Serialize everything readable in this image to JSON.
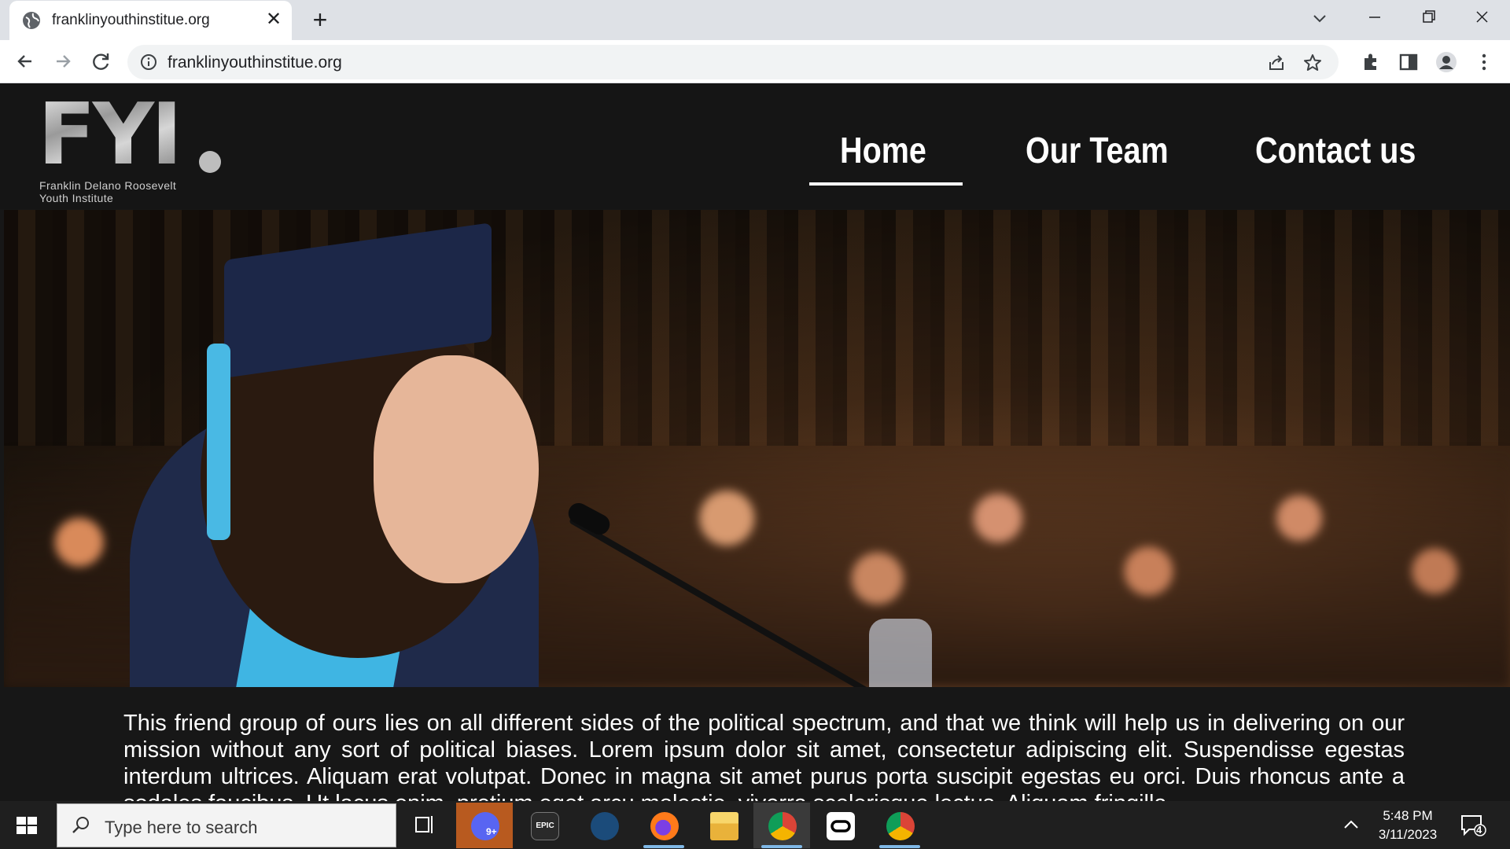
{
  "browser": {
    "tab_title": "franklinyouthinstitue.org",
    "url": "franklinyouthinstitue.org"
  },
  "site": {
    "logo_mark": "FYI",
    "logo_subtitle_line1": "Franklin Delano Roosevelt",
    "logo_subtitle_line2": "Youth Institute",
    "nav": [
      {
        "label": "Home",
        "active": true
      },
      {
        "label": "Our Team",
        "active": false
      },
      {
        "label": "Contact us",
        "active": false
      }
    ],
    "body_text": "This friend group of ours lies on all different sides of the political spectrum, and that we think will help us in delivering on our mission without any sort of political biases. Lorem ipsum dolor sit amet, consectetur adipiscing elit. Suspendisse egestas interdum ultrices. Aliquam erat volutpat. Donec in magna sit amet purus porta suscipit egestas eu orci. Duis rhoncus ante a sodales faucibus. Ut lacus enim, pretium eget arcu molestie, viverra scelerisque lectus. Aliquam fringilla"
  },
  "taskbar": {
    "search_placeholder": "Type here to search",
    "time": "5:48 PM",
    "date": "3/11/2023",
    "notification_count": "4",
    "discord_badge": "9+",
    "apps": [
      "discord",
      "epic-games",
      "steam",
      "firefox",
      "file-explorer",
      "chrome",
      "oculus",
      "chrome-profile"
    ]
  },
  "colors": {
    "page_bg": "#171717",
    "header_bg": "#151515",
    "nav_text": "#ffffff",
    "taskbar_bg": "#1f1f1f"
  }
}
